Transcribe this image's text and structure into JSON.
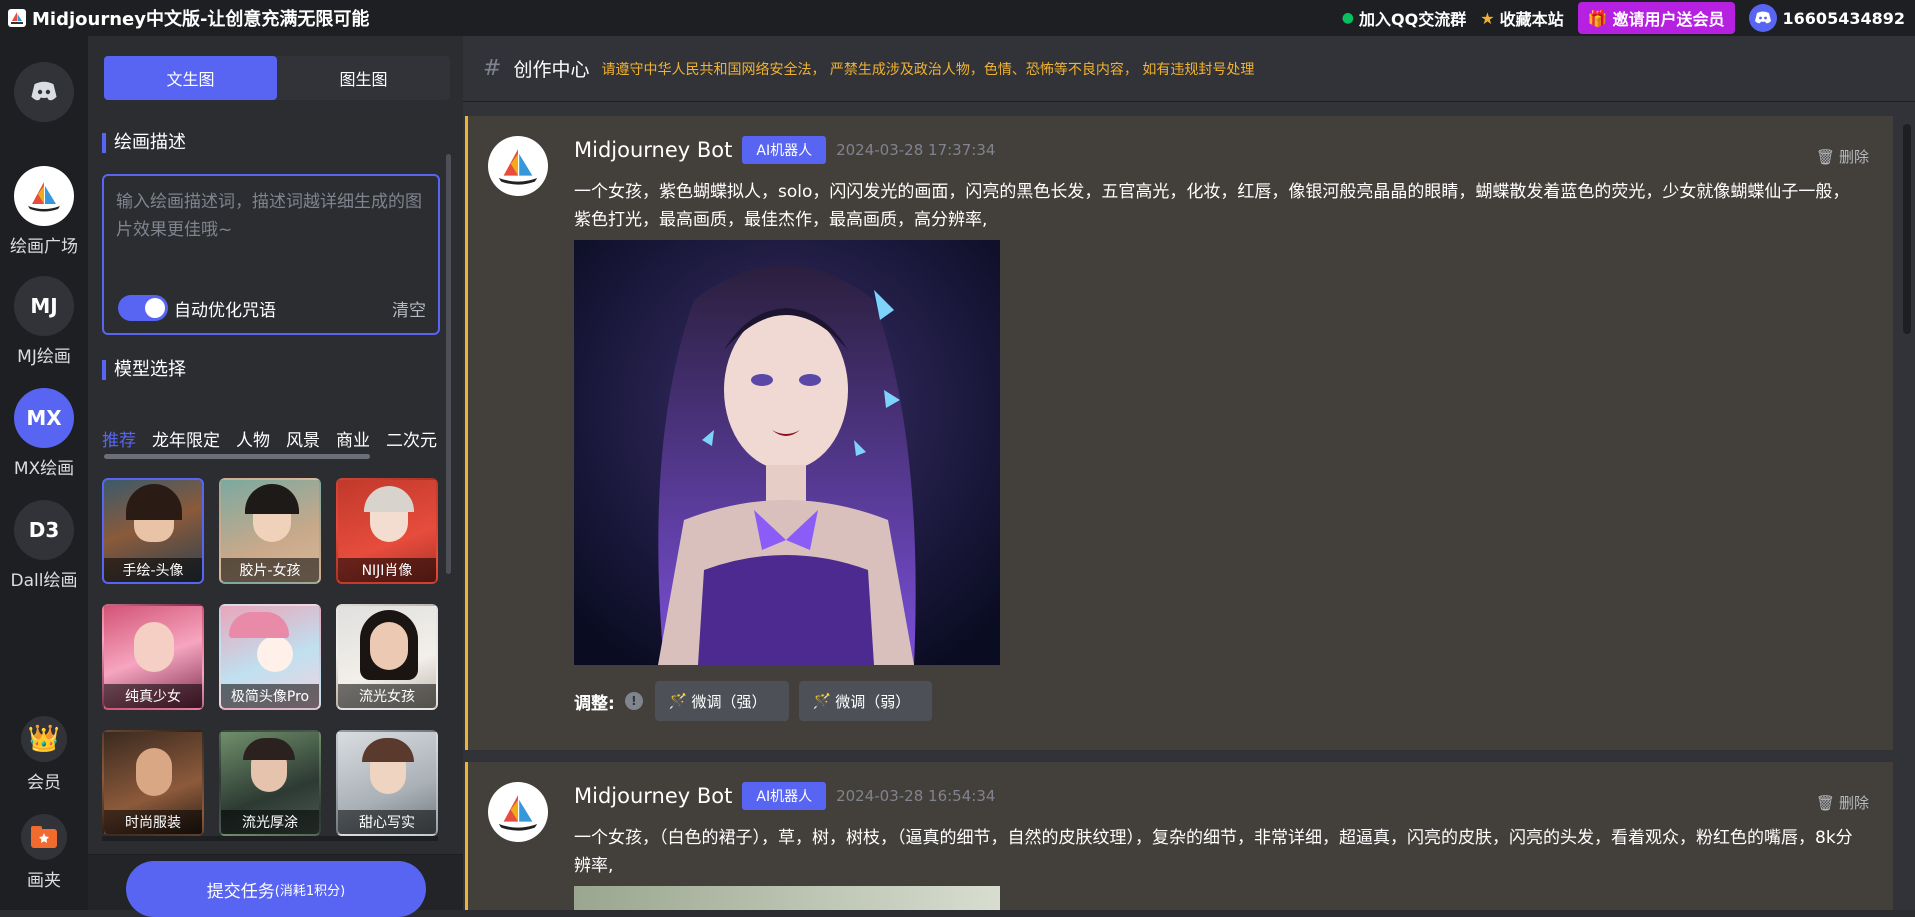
{
  "topbar": {
    "title": "Midjourney中文版-让创意充满无限可能",
    "qq_group": "加入QQ交流群",
    "bookmark": "收藏本站",
    "invite": "邀请用户送会员",
    "user_id": "16605434892"
  },
  "leftnav": {
    "items": [
      {
        "label": "绘画广场",
        "icon": "sailboat-logo-icon"
      },
      {
        "label": "MJ绘画",
        "badge": "MJ"
      },
      {
        "label": "MX绘画",
        "badge": "MX"
      },
      {
        "label": "Dall绘画",
        "badge": "D3"
      },
      {
        "label": "会员",
        "icon": "crown-icon"
      },
      {
        "label": "画夹",
        "icon": "folder-icon"
      }
    ]
  },
  "panel": {
    "tabs": [
      "文生图",
      "图生图"
    ],
    "prompt_title": "绘画描述",
    "prompt_placeholder": "输入绘画描述词，描述词越详细生成的图片效果更佳哦~",
    "auto_optimize": "自动优化咒语",
    "clear": "清空",
    "model_title": "模型选择",
    "categories": [
      "推荐",
      "龙年限定",
      "人物",
      "风景",
      "商业",
      "二次元"
    ],
    "models": [
      "手绘-头像",
      "胶片-女孩",
      "NIJI肖像",
      "纯真少女",
      "极简头像Pro",
      "流光女孩",
      "时尚服装",
      "流光厚涂",
      "甜心写实"
    ],
    "submit": "提交任务",
    "submit_cost": "(消耗1积分)"
  },
  "main": {
    "title": "创作中心",
    "notice": "请遵守中华人民共和国网络安全法， 严禁生成涉及政治人物，色情、恐怖等不良内容， 如有违规封号处理",
    "messages": [
      {
        "bot": "Midjourney Bot",
        "tag": "AI机器人",
        "time": "2024-03-28 17:37:34",
        "delete": "删除",
        "text": "一个女孩，紫色蝴蝶拟人，solo，闪闪发光的画面，闪亮的黑色长发，五官高光，化妆，红唇，像银河般亮晶晶的眼睛，蝴蝶散发着蓝色的荧光，少女就像蝴蝶仙子一般，紫色打光，最高画质，最佳杰作，最高画质，高分辨率,",
        "adjust": "调整:",
        "btn_strong": "微调（强）",
        "btn_weak": "微调（弱）"
      },
      {
        "bot": "Midjourney Bot",
        "tag": "AI机器人",
        "time": "2024-03-28 16:54:34",
        "delete": "删除",
        "text": "一个女孩，（白色的裙子），草，树，树枝，（逼真的细节，自然的皮肤纹理），复杂的细节，非常详细，超逼真，闪亮的皮肤，闪亮的头发，看着观众，粉红色的嘴唇，8k分辨率,"
      }
    ]
  },
  "colors": {
    "accent": "#5865f2",
    "warning": "#f0b232",
    "invite": "#b620e0"
  }
}
